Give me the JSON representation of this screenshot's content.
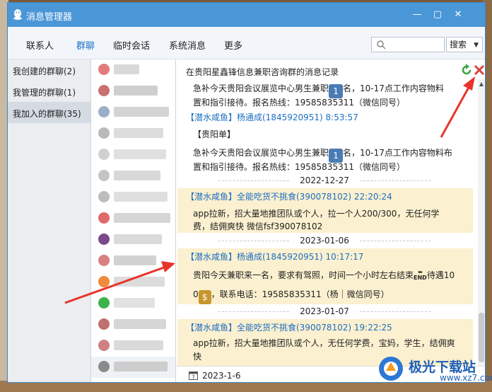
{
  "window": {
    "title": "消息管理器"
  },
  "nav": {
    "tabs": [
      "联系人",
      "群聊",
      "临时会话",
      "系统消息",
      "更多"
    ],
    "active": "群聊",
    "search_placeholder": "",
    "search_button": "搜索"
  },
  "groups": [
    "我创建的群聊(2)",
    "我管理的群聊(1)",
    "我加入的群聊(35)"
  ],
  "chat": {
    "title": "在贵阳星鑫锋信息兼职咨询群的消息记录",
    "msg1_line1": "急补今天贵阳会议展览中心男生兼职",
    "msg1_badge": "1",
    "msg1_line1b": "名，10-17点工作内容物料",
    "msg1_line2": "置和指引接待。报名热线：19585835311（微信同号）",
    "msg2_head": "【潜水咸鱼】杨通成(1845920951) 8:53:57",
    "msg2_line0": "【贵阳单】",
    "msg2_line1": "急补今天贵阳会议展览中心男生兼职",
    "msg2_badge": "1",
    "msg2_line1b": "名，10-17点工作内容物料布",
    "msg2_line2": "置和指引接待。报名热线：19585835311（微信同号）",
    "date1": "2022-12-27",
    "msg3_head": "【潜水咸鱼】全能吃货不挑食(390078102) 22:20:24",
    "msg3_line1": "app拉新，招大量地推团队或个人，拉一个人200/300，无任何学",
    "msg3_line2": "费，结佣爽快    微信fsf390078102",
    "date2": "2023-01-06",
    "msg4_head": "【潜水咸鱼】杨通成(1845920951) 10:17:17",
    "msg4_line1": "贵阳今天兼职来一名，要求有驾照，时间一个小时左右结束",
    "msg4_end": "END",
    "msg4_line1b": "待遇10",
    "msg4_line2b": "，联系电话：19585835311（杨｜微信同号）",
    "msg4_line2a": "0",
    "date3": "2023-01-07",
    "msg5_head": "【潜水咸鱼】全能吃货不挑食(390078102) 19:22:25",
    "msg5_line1": "app拉新，招大量地推团队或个人，无任何学费，宝妈，学生，结佣爽",
    "msg5_line2": "快",
    "selected_date": "2023-1-6"
  },
  "watermark": {
    "name": "极光下载站",
    "url": "www.xz7.com"
  },
  "colors": {
    "titlebar": "#4a97d8",
    "accent": "#1e6fc2",
    "highlight": "#fbf0cf",
    "arrow": "#e8352c"
  }
}
